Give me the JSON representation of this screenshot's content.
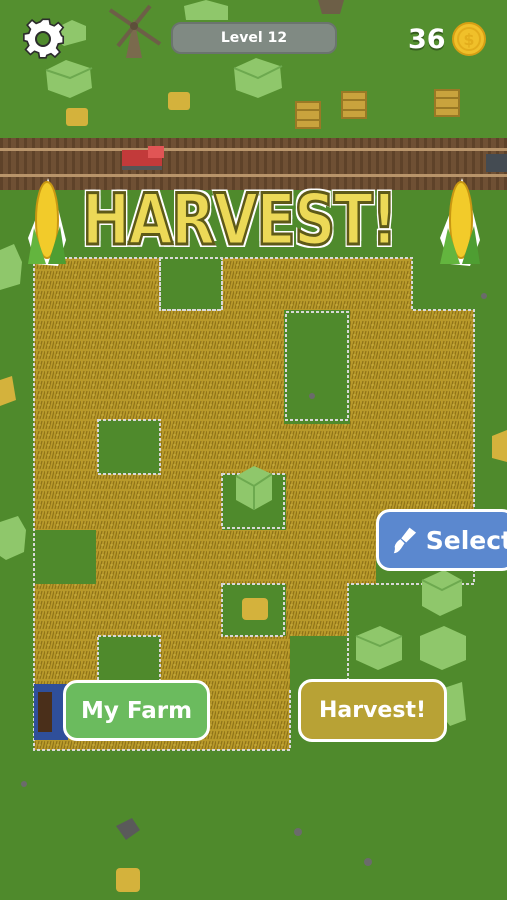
{
  "hud": {
    "level_label": "Level 12",
    "coin_count": "36"
  },
  "title": {
    "text": "HARVEST!"
  },
  "buttons": {
    "select_label": "Select",
    "my_farm_label": "My Farm",
    "harvest_label": "Harvest!"
  },
  "icons": {
    "settings": "gear-icon",
    "coin": "coin-icon",
    "paint_brush": "paint-brush-icon",
    "corn_left": "corn-icon",
    "corn_right": "corn-icon"
  },
  "colors": {
    "grass": "#4f8a2c",
    "crop": "#b99a2a",
    "select_button": "#5b88cf",
    "my_farm_button": "#6bbb5e",
    "harvest_button": "#b8a235",
    "level_pill": "#808a83",
    "coin": "#f0c02a",
    "title_fill": "#ecd957"
  }
}
